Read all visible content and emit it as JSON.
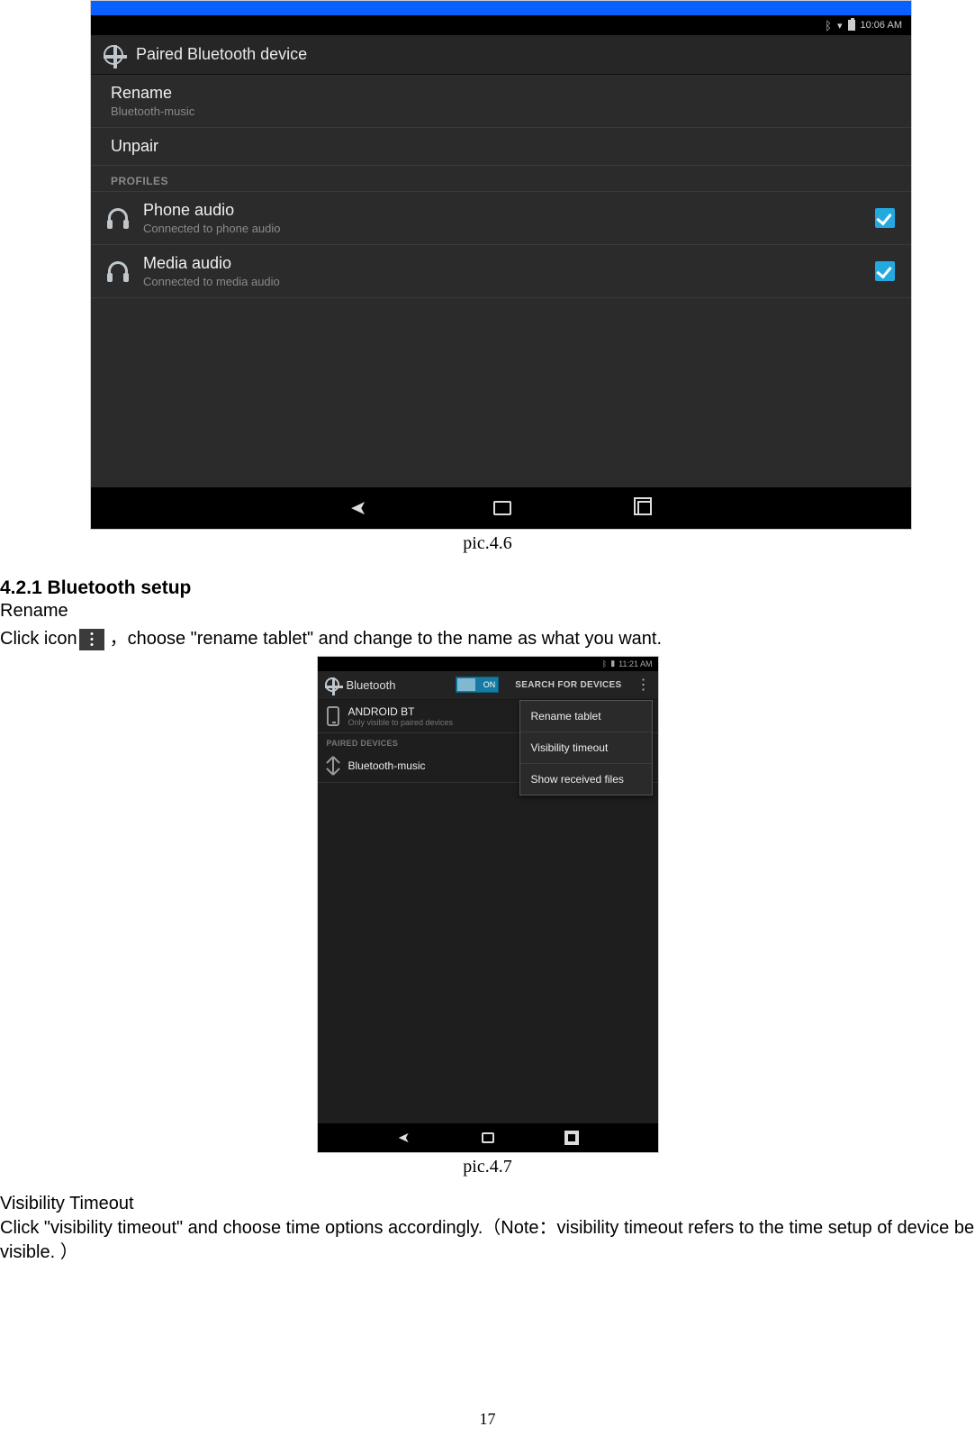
{
  "shot1": {
    "status_time": "10:06 AM",
    "title": "Paired Bluetooth device",
    "rename_label": "Rename",
    "rename_sub": "Bluetooth-music",
    "unpair_label": "Unpair",
    "profiles_label": "PROFILES",
    "phone_audio": {
      "title": "Phone audio",
      "sub": "Connected to phone audio"
    },
    "media_audio": {
      "title": "Media audio",
      "sub": "Connected to media audio"
    }
  },
  "captions": {
    "c1": "pic.4.6",
    "c2": "pic.4.7"
  },
  "text": {
    "heading": "4.2.1 Bluetooth setup",
    "rename_h": "Rename",
    "rename_pre": "Click icon",
    "rename_post": "，choose \"rename tablet\" and change to the name as what you want.",
    "vis_h": "Visibility Timeout",
    "vis_body": "Click \"visibility timeout\" and choose time options accordingly.（Note：visibility timeout refers to the time setup of device be visible. ）"
  },
  "shot2": {
    "status_time": "11:21 AM",
    "title": "Bluetooth",
    "toggle": "ON",
    "search": "SEARCH FOR DEVICES",
    "device": {
      "name": "ANDROID BT",
      "sub": "Only visible to paired devices"
    },
    "paired_label": "PAIRED DEVICES",
    "paired_item": "Bluetooth-music",
    "popup": {
      "rename": "Rename tablet",
      "visibility": "Visibility timeout",
      "show_files": "Show received files"
    }
  },
  "page_number": "17"
}
